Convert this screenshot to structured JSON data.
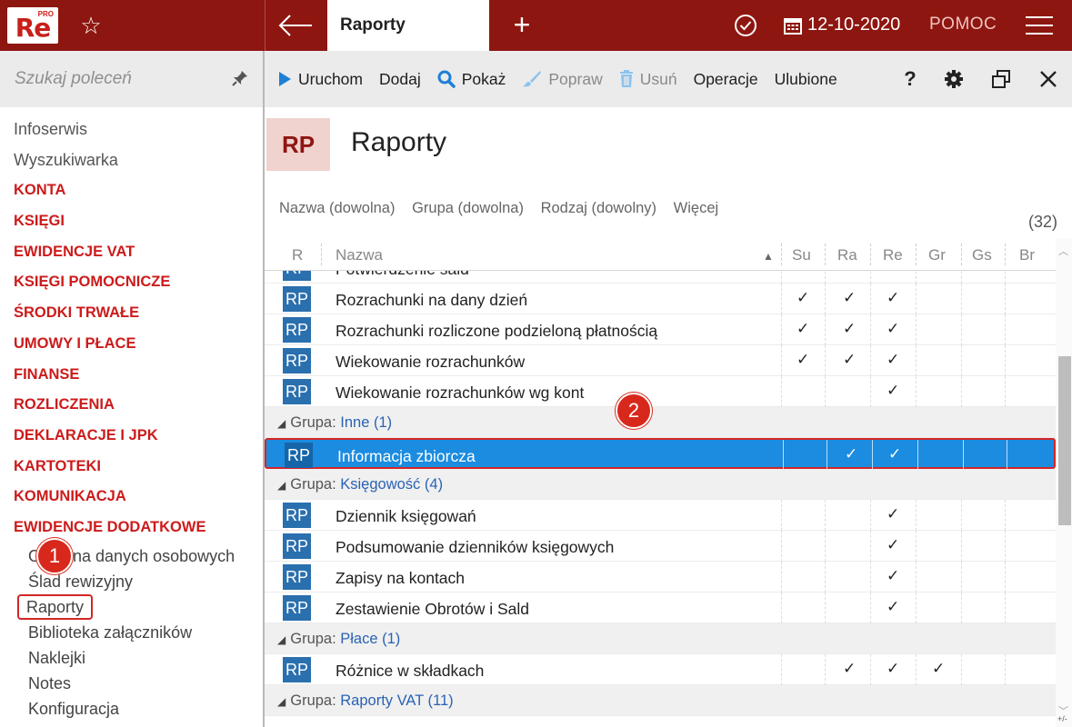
{
  "app": {
    "logo": "Re",
    "logo_badge": "PRO",
    "active_tab": "Raporty",
    "date": "12-10-2020",
    "help_label": "POMOC"
  },
  "sidebar": {
    "search_placeholder": "Szukaj poleceń",
    "items": [
      {
        "label": "Infoserwis",
        "type": "link"
      },
      {
        "label": "Wyszukiwarka",
        "type": "link"
      },
      {
        "label": "KONTA",
        "type": "section"
      },
      {
        "label": "KSIĘGI",
        "type": "section"
      },
      {
        "label": "EWIDENCJE VAT",
        "type": "section"
      },
      {
        "label": "KSIĘGI POMOCNICZE",
        "type": "section"
      },
      {
        "label": "ŚRODKI TRWAŁE",
        "type": "section"
      },
      {
        "label": "UMOWY I PŁACE",
        "type": "section"
      },
      {
        "label": "FINANSE",
        "type": "section"
      },
      {
        "label": "ROZLICZENIA",
        "type": "section"
      },
      {
        "label": "DEKLARACJE I JPK",
        "type": "section"
      },
      {
        "label": "KARTOTEKI",
        "type": "section"
      },
      {
        "label": "KOMUNIKACJA",
        "type": "section"
      },
      {
        "label": "EWIDENCJE DODATKOWE",
        "type": "section"
      }
    ],
    "subitems": [
      {
        "label": "Ochrona danych osobowych"
      },
      {
        "label": "Ślad rewizyjny"
      },
      {
        "label": "Raporty"
      },
      {
        "label": "Biblioteka załączników"
      },
      {
        "label": "Naklejki"
      },
      {
        "label": "Notes"
      },
      {
        "label": "Konfiguracja"
      }
    ],
    "badge": "1"
  },
  "toolbar": {
    "run": "Uruchom",
    "add": "Dodaj",
    "show": "Pokaż",
    "edit": "Popraw",
    "delete": "Usuń",
    "operations": "Operacje",
    "favorites": "Ulubione",
    "help": "?"
  },
  "header": {
    "icon_text": "RP",
    "title": "Raporty"
  },
  "filters": {
    "name": "Nazwa (dowolna)",
    "group": "Grupa (dowolna)",
    "kind": "Rodzaj (dowolny)",
    "more": "Więcej",
    "count": "(32)"
  },
  "grid": {
    "columns": [
      "R",
      "Nazwa",
      "Su",
      "Ra",
      "Re",
      "Gr",
      "Gs",
      "Br"
    ],
    "group_label": "Grupa:",
    "check": "✓",
    "rp": "RP",
    "rows": [
      {
        "kind": "item",
        "name": "Potwierdzenie sald",
        "su": false,
        "ra": false,
        "re": false,
        "gr": false
      },
      {
        "kind": "item",
        "name": "Rozrachunki na dany dzień",
        "su": true,
        "ra": true,
        "re": true,
        "gr": false
      },
      {
        "kind": "item",
        "name": "Rozrachunki rozliczone podzieloną płatnością",
        "su": true,
        "ra": true,
        "re": true,
        "gr": false
      },
      {
        "kind": "item",
        "name": "Wiekowanie rozrachunków",
        "su": true,
        "ra": true,
        "re": true,
        "gr": false
      },
      {
        "kind": "item",
        "name": "Wiekowanie rozrachunków wg kont",
        "su": false,
        "ra": false,
        "re": true,
        "gr": false
      },
      {
        "kind": "group",
        "name": "Inne",
        "count": "(1)"
      },
      {
        "kind": "item",
        "name": "Informacja zbiorcza",
        "su": false,
        "ra": true,
        "re": true,
        "gr": false,
        "selected": true
      },
      {
        "kind": "group",
        "name": "Księgowość",
        "count": "(4)"
      },
      {
        "kind": "item",
        "name": "Dziennik księgowań",
        "su": false,
        "ra": false,
        "re": true,
        "gr": false
      },
      {
        "kind": "item",
        "name": "Podsumowanie dzienników księgowych",
        "su": false,
        "ra": false,
        "re": true,
        "gr": false
      },
      {
        "kind": "item",
        "name": "Zapisy na kontach",
        "su": false,
        "ra": false,
        "re": true,
        "gr": false
      },
      {
        "kind": "item",
        "name": "Zestawienie Obrotów i Sald",
        "su": false,
        "ra": false,
        "re": true,
        "gr": false
      },
      {
        "kind": "group",
        "name": "Płace",
        "count": "(1)"
      },
      {
        "kind": "item",
        "name": "Różnice w składkach",
        "su": false,
        "ra": true,
        "re": true,
        "gr": true
      },
      {
        "kind": "group",
        "name": "Raporty VAT",
        "count": "(11)"
      }
    ],
    "badge": "2"
  },
  "scroll": {
    "corner": "+/-"
  },
  "colors": {
    "brand": "#8e1610",
    "selection": "#1b8ce0",
    "section_text": "#cc1b1b",
    "rp_icon": "#2a6fae",
    "badge": "#d8281c"
  }
}
